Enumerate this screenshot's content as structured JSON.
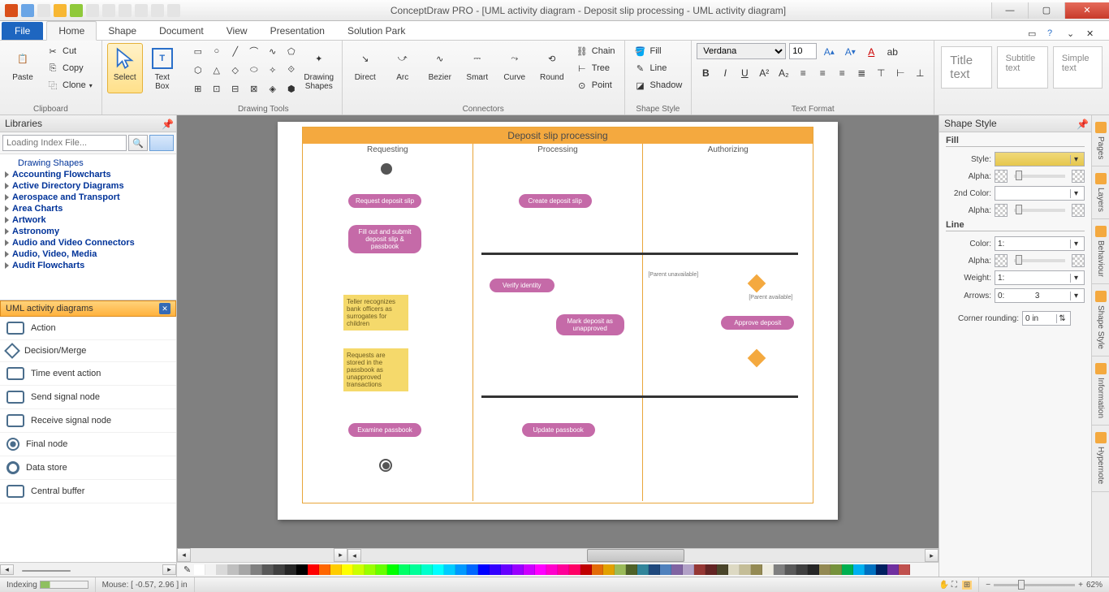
{
  "app_title": "ConceptDraw PRO - [UML activity diagram - Deposit slip processing - UML activity diagram]",
  "tabs": {
    "file": "File",
    "home": "Home",
    "shape": "Shape",
    "document": "Document",
    "view": "View",
    "presentation": "Presentation",
    "solution": "Solution Park"
  },
  "ribbon": {
    "clipboard": {
      "paste": "Paste",
      "cut": "Cut",
      "copy": "Copy",
      "clone": "Clone",
      "label": "Clipboard"
    },
    "select": "Select",
    "textbox": "Text\nBox",
    "drawing_label": "Drawing Tools",
    "drawing_shapes": "Drawing\nShapes",
    "connectors": {
      "direct": "Direct",
      "arc": "Arc",
      "bezier": "Bezier",
      "smart": "Smart",
      "curve": "Curve",
      "round": "Round",
      "chain": "Chain",
      "tree": "Tree",
      "point": "Point",
      "label": "Connectors"
    },
    "shapestyle": {
      "fill": "Fill",
      "line": "Line",
      "shadow": "Shadow",
      "label": "Shape Style"
    },
    "textformat": {
      "font": "Verdana",
      "size": "10",
      "label": "Text Format"
    },
    "styles": {
      "title": "Title text",
      "subtitle": "Subtitle text",
      "simple": "Simple text"
    }
  },
  "left": {
    "hdr": "Libraries",
    "search_placeholder": "Loading Index File...",
    "tree": [
      "Drawing Shapes",
      "Accounting Flowcharts",
      "Active Directory Diagrams",
      "Aerospace and Transport",
      "Area Charts",
      "Artwork",
      "Astronomy",
      "Audio and Video Connectors",
      "Audio, Video, Media",
      "Audit Flowcharts"
    ],
    "libname": "UML activity diagrams",
    "shapes": [
      "Action",
      "Decision/Merge",
      "Time event action",
      "Send signal node",
      "Receive signal node",
      "Final node",
      "Data store",
      "Central buffer"
    ]
  },
  "diagram": {
    "title": "Deposit slip processing",
    "lanes": [
      "Requesting",
      "Processing",
      "Authorizing"
    ],
    "acts": {
      "request": "Request deposit slip",
      "create": "Create deposit slip",
      "fillout": "Fill out and submit deposit slip & passbook",
      "verify": "Verify identity",
      "mark": "Mark deposit as unapproved",
      "approve": "Approve deposit",
      "examine": "Examine passbook",
      "update": "Update passbook"
    },
    "notes": {
      "n1": "Teller recognizes bank officers as surrogates for children",
      "n2": "Requests are stored in the passbook as unapproved transactions"
    },
    "guards": {
      "g1": "[Parent unavailable]",
      "g2": "[Parent available]"
    }
  },
  "right": {
    "hdr": "Shape Style",
    "fill": "Fill",
    "line": "Line",
    "style": "Style:",
    "alpha": "Alpha:",
    "second": "2nd Color:",
    "color": "Color:",
    "weight": "Weight:",
    "arrows": "Arrows:",
    "corner": "Corner rounding:",
    "weight_val": "1:",
    "arrows_val": "0:",
    "arrows_r": "3",
    "corner_val": "0 in",
    "tabs": [
      "Pages",
      "Layers",
      "Behaviour",
      "Shape Style",
      "Information",
      "Hypernote"
    ]
  },
  "status": {
    "indexing": "Indexing",
    "mouse": "Mouse: [ -0.57, 2.96 ] in",
    "zoom": "62%"
  },
  "colors": [
    "#ffffff",
    "#f2f2f2",
    "#d9d9d9",
    "#bfbfbf",
    "#a6a6a6",
    "#808080",
    "#595959",
    "#404040",
    "#262626",
    "#000000",
    "#ff0000",
    "#ff6600",
    "#ffcc00",
    "#ffff00",
    "#ccff00",
    "#99ff00",
    "#66ff00",
    "#00ff00",
    "#00ff66",
    "#00ff99",
    "#00ffcc",
    "#00ffff",
    "#00ccff",
    "#0099ff",
    "#0066ff",
    "#0000ff",
    "#3300ff",
    "#6600ff",
    "#9900ff",
    "#cc00ff",
    "#ff00ff",
    "#ff00cc",
    "#ff0099",
    "#ff0066",
    "#c00000",
    "#e36c09",
    "#e2a100",
    "#9bbb59",
    "#4f6228",
    "#31859b",
    "#1f497d",
    "#4f81bd",
    "#8064a2",
    "#b2a1c7",
    "#953734",
    "#632423",
    "#4a452a",
    "#ddd9c3",
    "#c4bd97",
    "#948a54",
    "#eeece1",
    "#7f7f7f",
    "#595959",
    "#3f3f3f",
    "#262626",
    "#938953",
    "#76923c",
    "#00b050",
    "#00b0f0",
    "#0070c0",
    "#002060",
    "#7030a0",
    "#c0504d"
  ]
}
